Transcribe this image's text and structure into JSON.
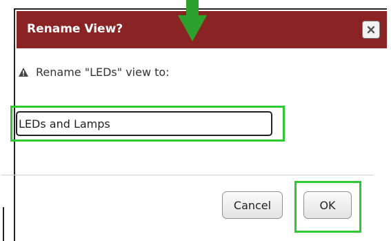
{
  "dialog": {
    "title": "Rename View?",
    "message": "Rename \"LEDs\" view to:",
    "input_value": "LEDs and Lamps",
    "close_icon": "close-icon",
    "warning_icon": "warning-icon"
  },
  "buttons": {
    "cancel_label": "Cancel",
    "ok_label": "OK"
  },
  "annotations": {
    "highlight_color": "#2ec92e",
    "arrow_icon": "down-arrow-icon"
  },
  "colors": {
    "titlebar": "#8a2323"
  }
}
